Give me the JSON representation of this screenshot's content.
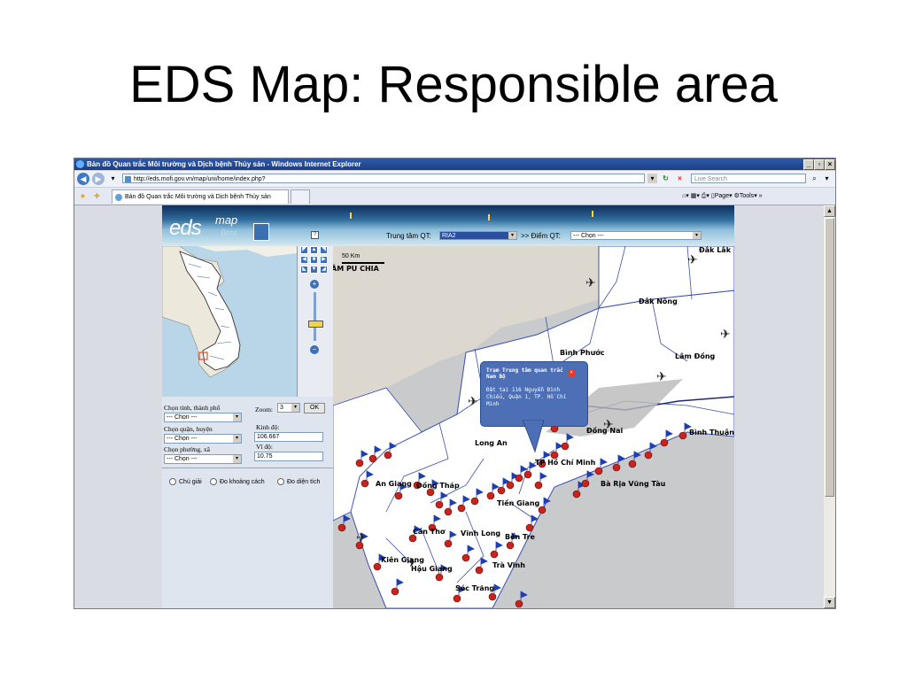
{
  "slide": {
    "title": "EDS Map: Responsible area"
  },
  "browser": {
    "window_title": "Bản đồ Quan trắc Môi trường và Dịch bệnh Thủy sản - Windows Internet Explorer",
    "address": "http://eds.mofi.gov.vn/map/uni/home/index.php?",
    "search_placeholder": "Live Search",
    "tab_label": "Bản đồ Quan trắc Môi trường và Dịch bệnh Thủy sản",
    "page_menu": "Page",
    "tools_menu": "Tools"
  },
  "app": {
    "logo": "eds",
    "logo_sup": "map",
    "logo_beta": "Beta",
    "center_label": "Trung tâm QT:",
    "center_value": "RIA2",
    "point_label": ">> Điểm QT:",
    "point_value": "--- Chọn ---",
    "zoom_label": "Zoom:",
    "zoom_value": "3",
    "ok_label": "OK",
    "province_label": "Chọn tỉnh, thành phố",
    "province_value": "--- Chọn ---",
    "district_label": "Chọn quận, huyện",
    "district_value": "--- Chọn ---",
    "ward_label": "Chọn phường, xã",
    "ward_value": "--- Chọn ---",
    "lon_label": "Kinh độ:",
    "lon_value": "106.667",
    "lat_label": "Vĩ độ:",
    "lat_value": "10.75",
    "radio_legend": "Chú giải",
    "radio_distance": "Đo khoảng cách",
    "radio_area": "Đo diện tích",
    "scale_label": "50 Km"
  },
  "map_labels": [
    "ÂM PU CHIA",
    "Đắk Lắk",
    "Đắk Nông",
    "Bình Phước",
    "Lâm Đồng",
    "Đồng Nai",
    "Bình Thuận",
    "Long An",
    "TP Hồ Chí Minh",
    "An Giang",
    "Đồng Tháp",
    "Tiền Giang",
    "Bà Rịa Vũng Tàu",
    "Cần Thơ",
    "Vĩnh Long",
    "Bến Tre",
    "Kiên Giang",
    "Hậu Giang",
    "Trà Vinh",
    "Sóc Trăng"
  ],
  "popup": {
    "title": "Trạm Trung tâm quan trắc Nam Bộ",
    "body": "Đặt tại 116 Nguyễn Đình Chiểu, Quận 1, TP. Hồ Chí Minh"
  }
}
